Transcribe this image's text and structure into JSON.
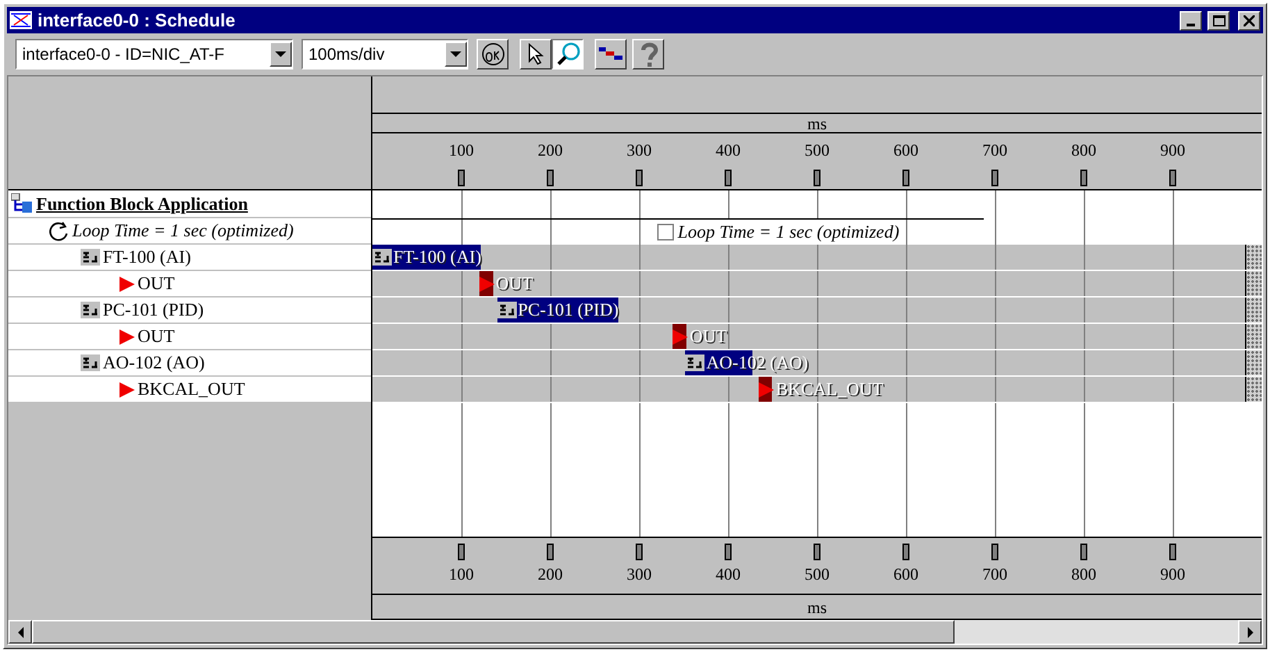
{
  "window": {
    "title": "interface0-0 : Schedule"
  },
  "toolbar": {
    "device": "interface0-0 - ID=NIC_AT-F",
    "resolution": "100ms/div",
    "tools": [
      {
        "kind": "ok",
        "selected": false,
        "disabled": false
      },
      {
        "kind": "pointer",
        "selected": false,
        "disabled": false
      },
      {
        "kind": "zoom",
        "selected": true,
        "disabled": false
      },
      {
        "kind": "schedule",
        "selected": false,
        "disabled": false
      },
      {
        "kind": "help",
        "selected": false,
        "disabled": true
      }
    ]
  },
  "tree": {
    "label": "Function Block Application",
    "children": [
      {
        "label": "Loop Time = 1 sec (optimized)",
        "kind": "loop",
        "children": [
          {
            "label": "FT-100 (AI)",
            "kind": "block",
            "children": [
              {
                "label": "OUT",
                "kind": "output"
              }
            ]
          },
          {
            "label": "PC-101 (PID)",
            "kind": "block",
            "children": [
              {
                "label": "OUT",
                "kind": "output"
              }
            ]
          },
          {
            "label": "AO-102 (AO)",
            "kind": "block",
            "children": [
              {
                "label": "BKCAL_OUT",
                "kind": "output"
              }
            ]
          }
        ]
      }
    ]
  },
  "timeline": {
    "top_axis": {
      "label": "ms",
      "ticks": [
        "100",
        "200",
        "300",
        "400",
        "500",
        "600",
        "700",
        "800",
        "900"
      ]
    },
    "loop_marker": {
      "label": "Loop Time = 1 sec (optimized)",
      "checked": false
    },
    "bars": [
      {
        "label": "FT-100 (AI)",
        "kind": "block"
      },
      {
        "label": "OUT",
        "kind": "output"
      },
      {
        "label": "PC-101 (PID)",
        "kind": "block"
      },
      {
        "label": "OUT",
        "kind": "output"
      },
      {
        "label": "AO-102 (AO)",
        "kind": "block"
      },
      {
        "label": "BKCAL_OUT",
        "kind": "output"
      }
    ],
    "bottom_axis": {
      "ticks": [
        "100",
        "200",
        "300",
        "400",
        "500",
        "600",
        "700",
        "800",
        "900"
      ],
      "label": "ms"
    }
  }
}
